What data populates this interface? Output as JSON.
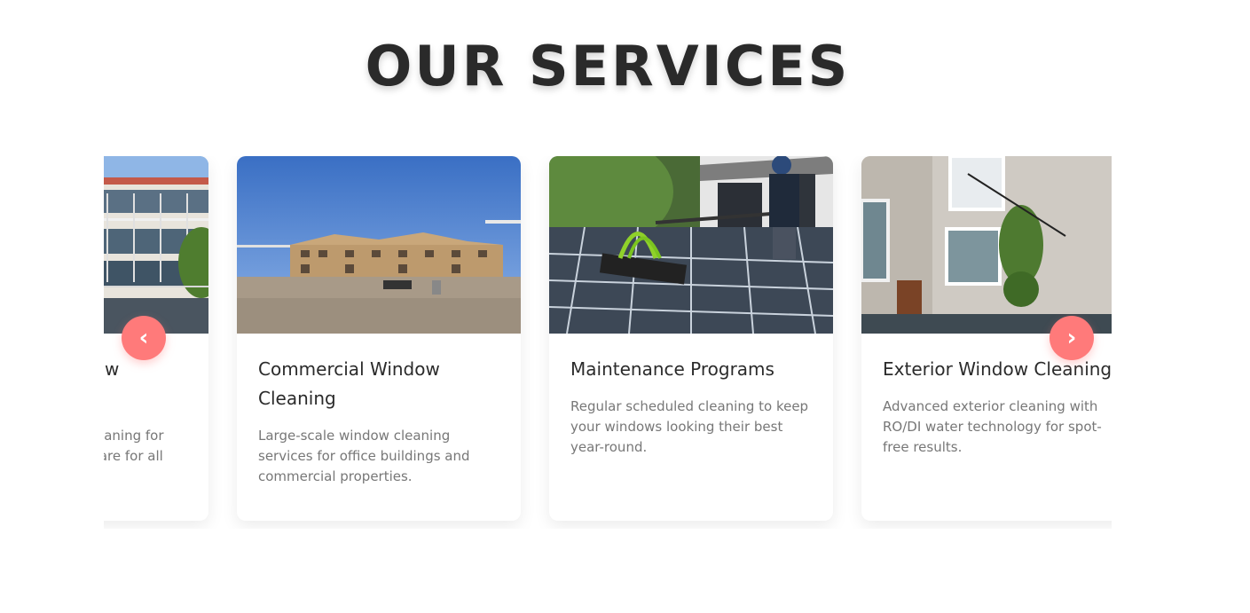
{
  "section": {
    "title": "OUR SERVICES"
  },
  "carousel": {
    "prev_label": "‹",
    "next_label": "›",
    "accent_color": "#ff7a7a"
  },
  "cards": [
    {
      "title": "Residential Window Cleaning",
      "description": "Professional window cleaning for homes with thorough care for all surfaces.",
      "image": "residential-building-photo"
    },
    {
      "title": "Commercial Window Cleaning",
      "description": "Large-scale window cleaning services for office buildings and commercial properties.",
      "image": "commercial-building-photo"
    },
    {
      "title": "Maintenance Programs",
      "description": "Regular scheduled cleaning to keep your windows looking their best year-round.",
      "image": "solar-panel-cleaning-photo"
    },
    {
      "title": "Exterior Window Cleaning",
      "description": "Advanced exterior cleaning with RO/DI water technology for spot-free results.",
      "image": "exterior-window-photo"
    }
  ]
}
